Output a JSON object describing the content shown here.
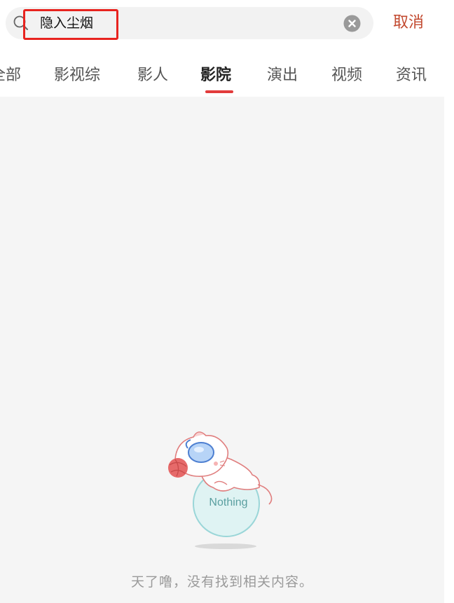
{
  "search": {
    "value": "隐入尘烟",
    "cancel_label": "取消"
  },
  "tabs": [
    {
      "label": "全部",
      "active": false
    },
    {
      "label": "影视综",
      "active": false
    },
    {
      "label": "影人",
      "active": false
    },
    {
      "label": "影院",
      "active": true
    },
    {
      "label": "演出",
      "active": false
    },
    {
      "label": "视频",
      "active": false
    },
    {
      "label": "资讯",
      "active": false
    }
  ],
  "empty_state": {
    "illustration_text": "Nothing",
    "message": "天了噜，没有找到相关内容。"
  },
  "colors": {
    "accent": "#c2492f",
    "tab_indicator": "#e23b3b",
    "highlight_box": "#e8231f",
    "background": "#f5f5f5"
  },
  "icons": [
    "search-icon",
    "clear-icon"
  ]
}
